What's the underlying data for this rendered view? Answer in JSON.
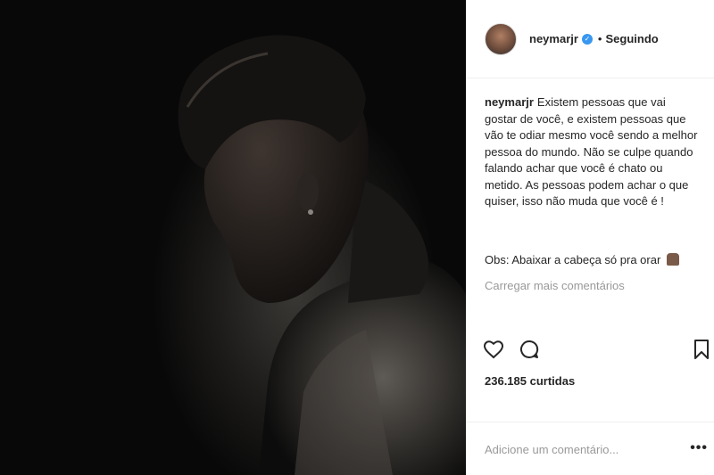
{
  "post": {
    "username": "neymarjr",
    "follow_status": "Seguindo",
    "separator": "•"
  },
  "caption": {
    "username": "neymarjr",
    "text": "Existem pessoas que vai gostar de você, e existem pessoas que vão te odiar mesmo você sendo a melhor pessoa do mundo. Não se culpe quando falando achar que você é chato ou metido. As pessoas podem achar o que quiser, isso não muda que você é !",
    "obs": "Obs: Abaixar a cabeça só pra orar"
  },
  "load_more": "Carregar mais comentários",
  "likes_count": "236.185 curtidas",
  "comment": {
    "placeholder": "Adicione um comentário...",
    "more_options": "•••"
  },
  "icons": {
    "verified": "verified-badge-icon",
    "like": "heart-icon",
    "comment": "comment-bubble-icon",
    "save": "bookmark-icon",
    "pray": "praying-hands-icon"
  },
  "colors": {
    "verified_blue": "#3897f0",
    "muted_text": "#999999",
    "text": "#262626"
  }
}
